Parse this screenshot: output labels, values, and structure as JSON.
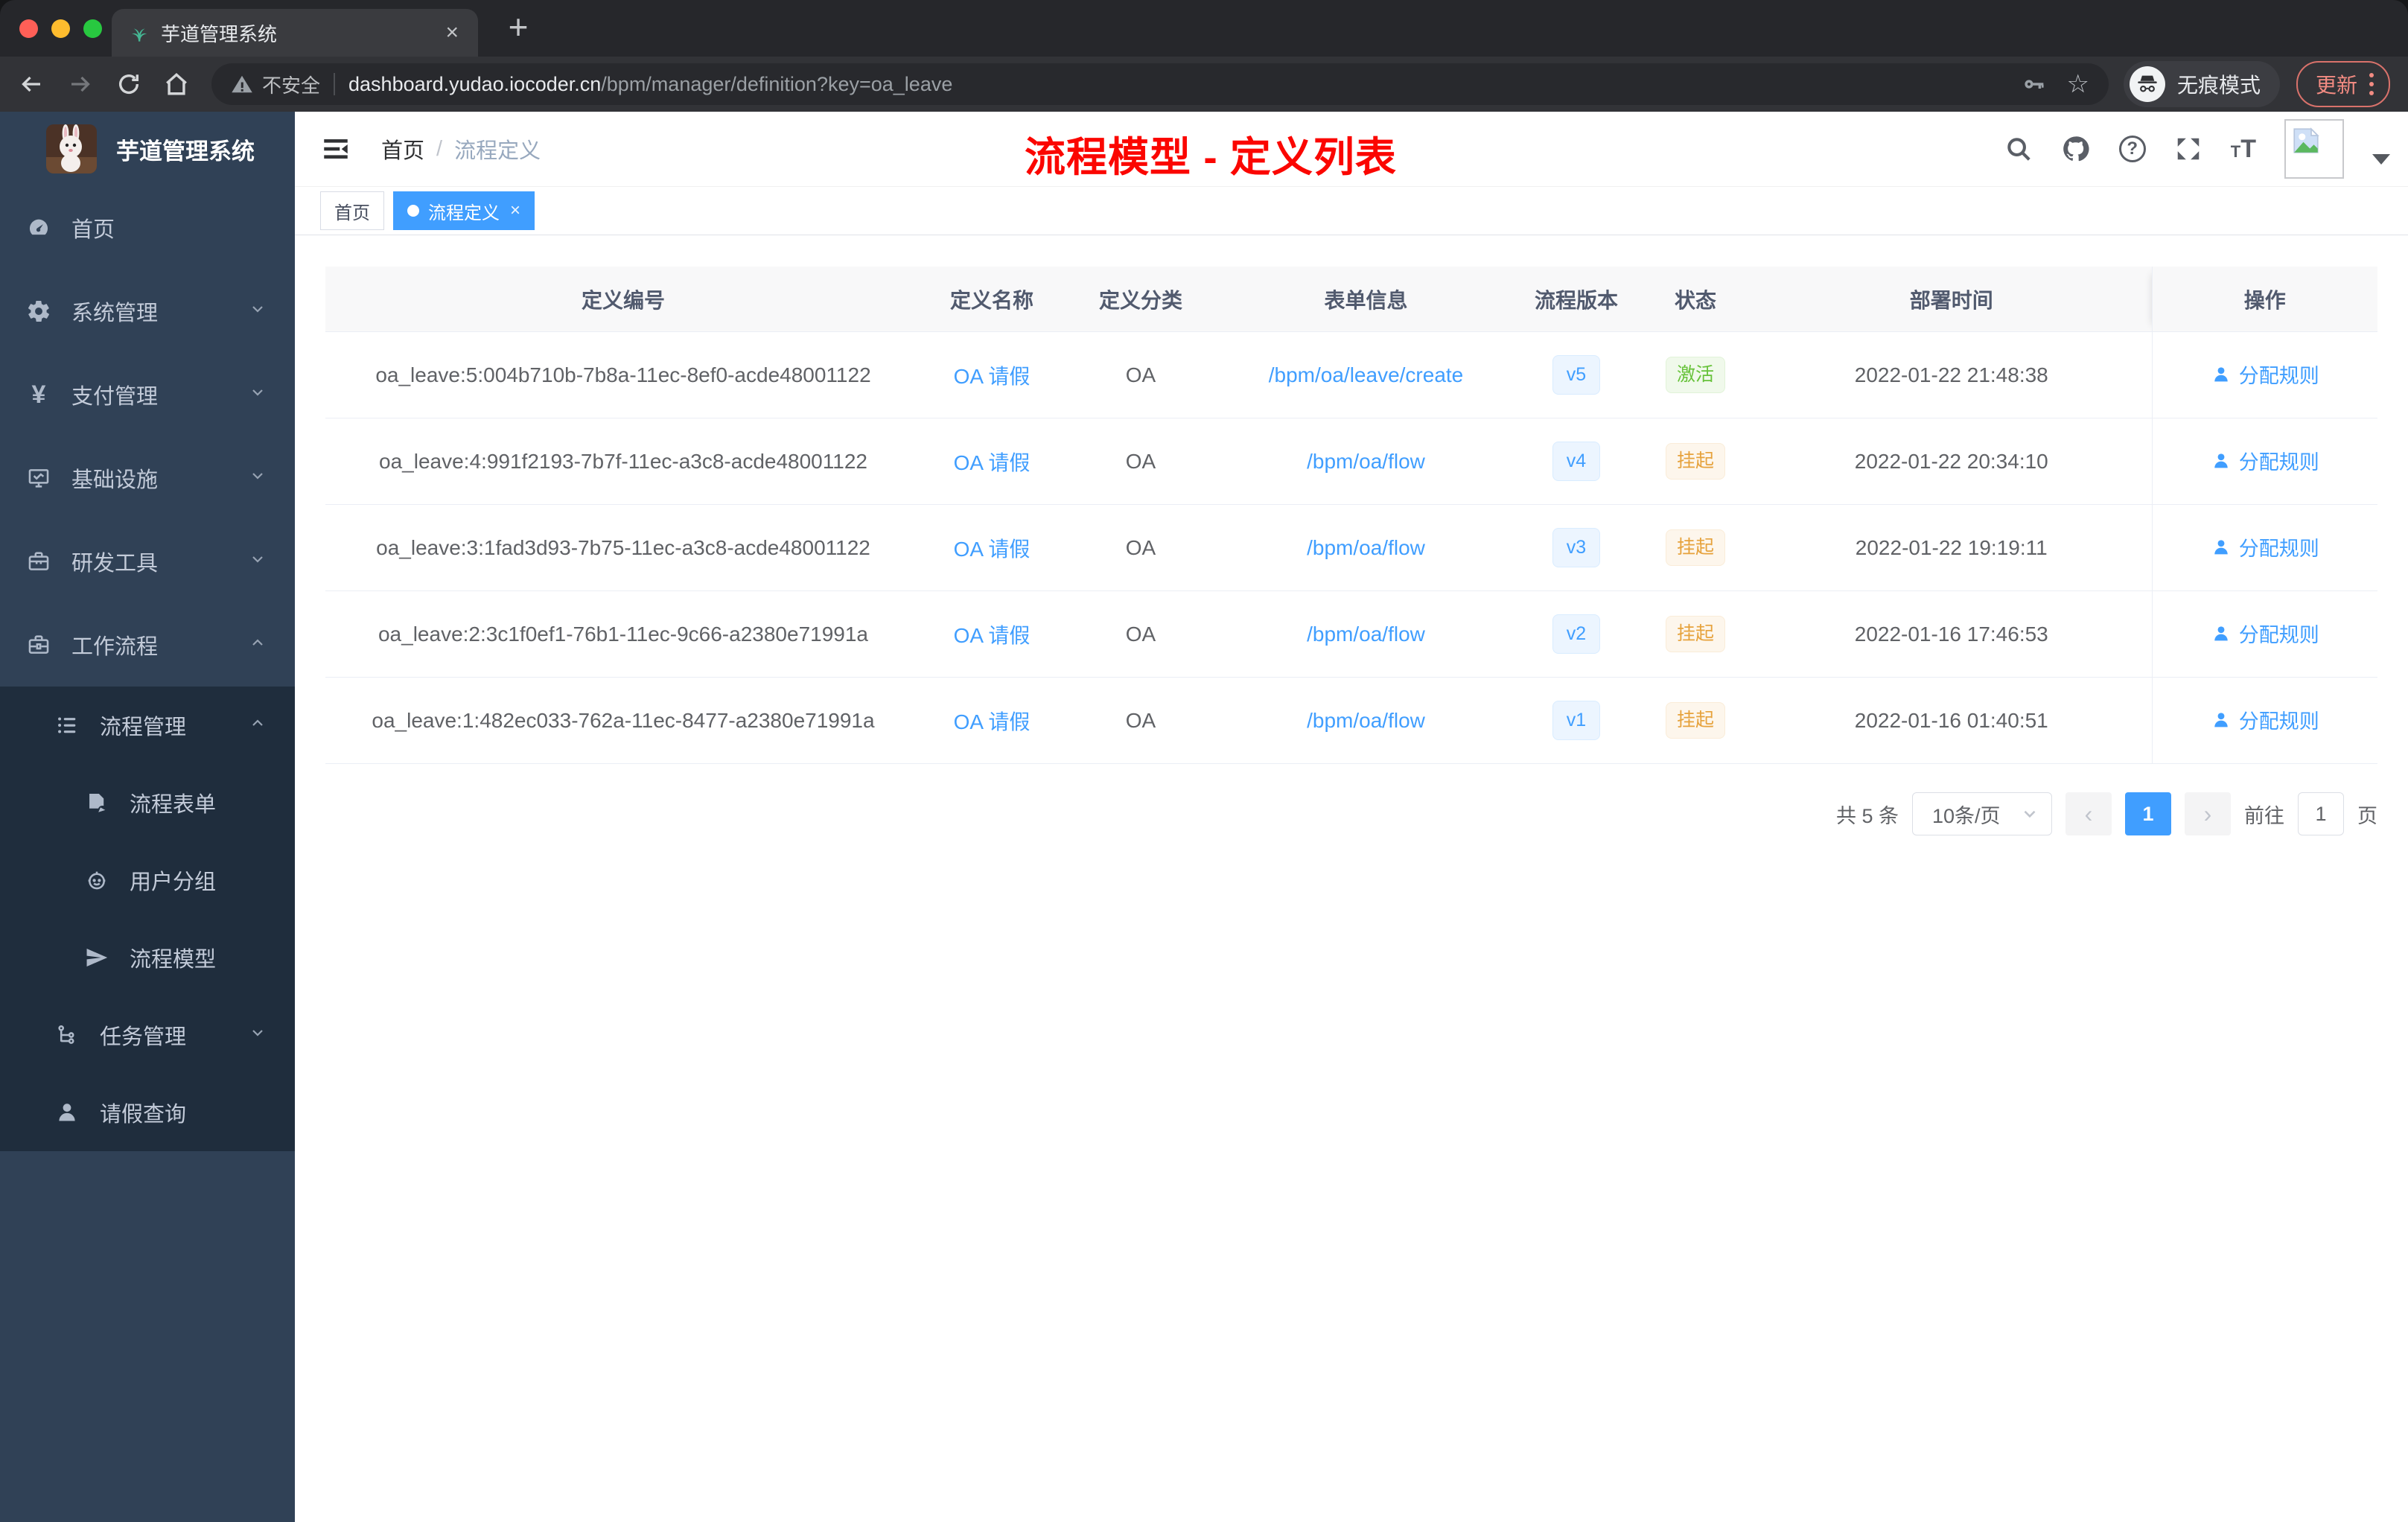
{
  "colors": {
    "accent": "#409eff",
    "success": "#67c23a",
    "warning": "#e6a23c",
    "annotation_red": "#fb0600",
    "sidebar_bg": "#304156",
    "submenu_bg": "#1f2d3d"
  },
  "browser": {
    "tab_title": "芋道管理系统",
    "favicon": "seedling-icon",
    "security_label": "不安全",
    "url_host": "dashboard.yudao.iocoder.cn",
    "url_path": "/bpm/manager/definition?key=oa_leave",
    "incognito_label": "无痕模式",
    "update_label": "更新"
  },
  "sidebar": {
    "brand": "芋道管理系统",
    "menu": [
      {
        "label": "首页",
        "icon": "gauge-icon",
        "level": 1,
        "expand": null,
        "in_submenu": false
      },
      {
        "label": "系统管理",
        "icon": "gear-icon",
        "level": 1,
        "expand": "down",
        "in_submenu": false
      },
      {
        "label": "支付管理",
        "icon": "yen-icon",
        "level": 1,
        "expand": "down",
        "in_submenu": false
      },
      {
        "label": "基础设施",
        "icon": "monitor-icon",
        "level": 1,
        "expand": "down",
        "in_submenu": false
      },
      {
        "label": "研发工具",
        "icon": "toolbox-icon",
        "level": 1,
        "expand": "down",
        "in_submenu": false
      },
      {
        "label": "工作流程",
        "icon": "briefcase-icon",
        "level": 1,
        "expand": "up",
        "in_submenu": false
      },
      {
        "label": "流程管理",
        "icon": "list-icon",
        "level": 2,
        "expand": "up",
        "in_submenu": true
      },
      {
        "label": "流程表单",
        "icon": "form-icon",
        "level": 3,
        "expand": null,
        "in_submenu": true
      },
      {
        "label": "用户分组",
        "icon": "robot-icon",
        "level": 3,
        "expand": null,
        "in_submenu": true
      },
      {
        "label": "流程模型",
        "icon": "send-icon",
        "level": 3,
        "expand": null,
        "in_submenu": true
      },
      {
        "label": "任务管理",
        "icon": "tree-icon",
        "level": 2,
        "expand": "down",
        "in_submenu": true
      },
      {
        "label": "请假查询",
        "icon": "user-icon",
        "level": 2,
        "expand": null,
        "in_submenu": true
      }
    ]
  },
  "header": {
    "breadcrumb": {
      "home": "首页",
      "separator": "/",
      "current": "流程定义"
    },
    "annotation": "流程模型 - 定义列表"
  },
  "tags": [
    {
      "label": "首页",
      "active": false,
      "closable": false
    },
    {
      "label": "流程定义",
      "active": true,
      "closable": true
    }
  ],
  "table": {
    "columns": [
      "定义编号",
      "定义名称",
      "定义分类",
      "表单信息",
      "流程版本",
      "状态",
      "部署时间",
      "操作"
    ],
    "rows": [
      {
        "id": "oa_leave:5:004b710b-7b8a-11ec-8ef0-acde48001122",
        "name": "OA 请假",
        "category": "OA",
        "form": "/bpm/oa/leave/create",
        "version": "v5",
        "status": "激活",
        "status_type": "success",
        "deploy_time": "2022-01-22 21:48:38",
        "action": "分配规则"
      },
      {
        "id": "oa_leave:4:991f2193-7b7f-11ec-a3c8-acde48001122",
        "name": "OA 请假",
        "category": "OA",
        "form": "/bpm/oa/flow",
        "version": "v4",
        "status": "挂起",
        "status_type": "warning",
        "deploy_time": "2022-01-22 20:34:10",
        "action": "分配规则"
      },
      {
        "id": "oa_leave:3:1fad3d93-7b75-11ec-a3c8-acde48001122",
        "name": "OA 请假",
        "category": "OA",
        "form": "/bpm/oa/flow",
        "version": "v3",
        "status": "挂起",
        "status_type": "warning",
        "deploy_time": "2022-01-22 19:19:11",
        "action": "分配规则"
      },
      {
        "id": "oa_leave:2:3c1f0ef1-76b1-11ec-9c66-a2380e71991a",
        "name": "OA 请假",
        "category": "OA",
        "form": "/bpm/oa/flow",
        "version": "v2",
        "status": "挂起",
        "status_type": "warning",
        "deploy_time": "2022-01-16 17:46:53",
        "action": "分配规则"
      },
      {
        "id": "oa_leave:1:482ec033-762a-11ec-8477-a2380e71991a",
        "name": "OA 请假",
        "category": "OA",
        "form": "/bpm/oa/flow",
        "version": "v1",
        "status": "挂起",
        "status_type": "warning",
        "deploy_time": "2022-01-16 01:40:51",
        "action": "分配规则"
      }
    ]
  },
  "pagination": {
    "total": "共 5 条",
    "page_size": "10条/页",
    "current_page": "1",
    "goto_label": "前往",
    "goto_value": "1",
    "goto_unit": "页"
  }
}
